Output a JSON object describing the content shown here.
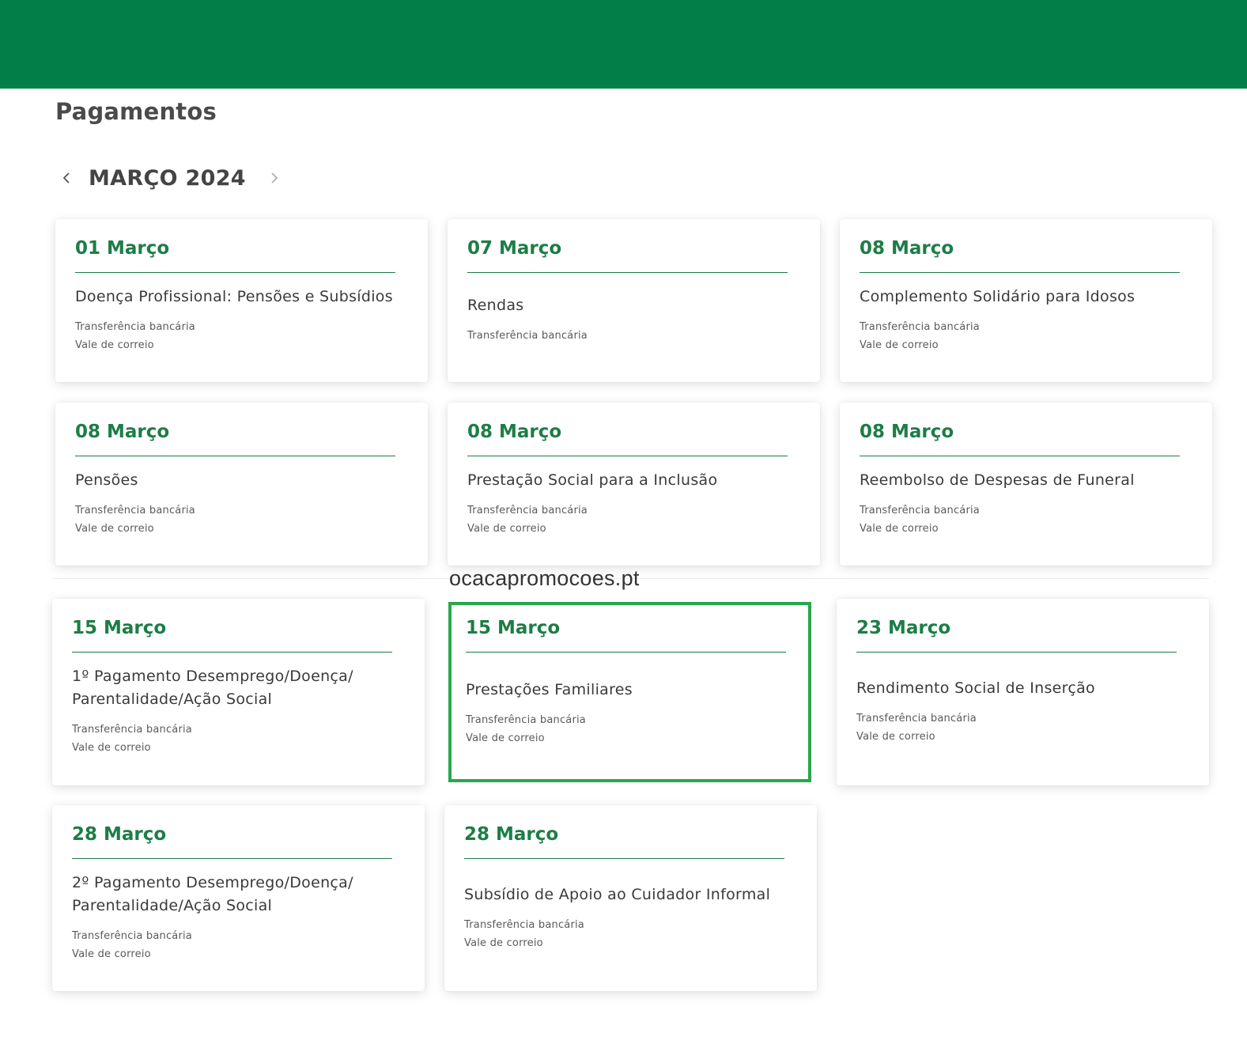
{
  "header": {
    "title": "Pagamentos"
  },
  "calendar": {
    "month_label": "MARÇO 2024"
  },
  "watermark": "ocacapromocoes.pt",
  "colors": {
    "brand_green": "#008048",
    "date_green": "#1d7d46",
    "highlight_border": "#28a74b"
  },
  "icons": {
    "prev": "chevron-left-icon",
    "next": "chevron-right-icon"
  },
  "cards": [
    {
      "date": "01 Março",
      "title": "Doença Profissional: Pensões e Subsídios",
      "methods": [
        "Transferência bancária",
        "Vale de correio"
      ]
    },
    {
      "date": "07 Março",
      "title": "Rendas",
      "methods": [
        "Transferência bancária"
      ]
    },
    {
      "date": "08 Março",
      "title": "Complemento Solidário para Idosos",
      "methods": [
        "Transferência bancária",
        "Vale de correio"
      ]
    },
    {
      "date": "08 Março",
      "title": "Pensões",
      "methods": [
        "Transferência bancária",
        "Vale de correio"
      ]
    },
    {
      "date": "08 Março",
      "title": "Prestação Social para a Inclusão",
      "methods": [
        "Transferência bancária",
        "Vale de correio"
      ]
    },
    {
      "date": "08 Março",
      "title": "Reembolso de Despesas de Funeral",
      "methods": [
        "Transferência bancária",
        "Vale de correio"
      ]
    },
    {
      "date": "15 Março",
      "title_lines": [
        "1º Pagamento Desemprego/Doença/",
        "Parentalidade/Ação Social"
      ],
      "methods": [
        "Transferência bancária",
        "Vale de correio"
      ]
    },
    {
      "date": "15 Março",
      "title": "Prestações Familiares",
      "methods": [
        "Transferência bancária",
        "Vale de correio"
      ]
    },
    {
      "date": "23 Março",
      "title": "Rendimento Social de Inserção",
      "methods": [
        "Transferência bancária",
        "Vale de correio"
      ]
    },
    {
      "date": "28 Março",
      "title_lines": [
        "2º Pagamento Desemprego/Doença/",
        "Parentalidade/Ação Social"
      ],
      "methods": [
        "Transferência bancária",
        "Vale de correio"
      ]
    },
    {
      "date": "28 Março",
      "title": "Subsídio de Apoio ao Cuidador Informal",
      "methods": [
        "Transferência bancária",
        "Vale de correio"
      ]
    }
  ]
}
